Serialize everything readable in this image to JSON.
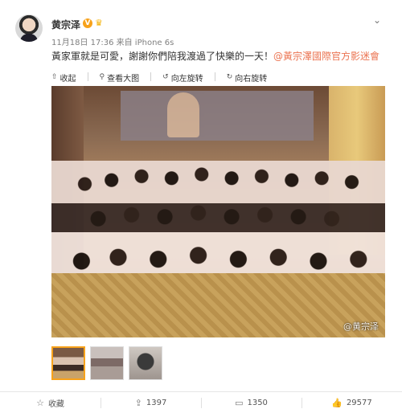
{
  "post": {
    "username": "黄宗泽",
    "verified_badge": "V",
    "meta": "11月18日 17:36 来自 iPhone 6s",
    "text_main": "黃家軍就是可愛，謝謝你們陪我渡過了快樂的一天！",
    "text_mention": "@黃宗澤國際官方影迷會",
    "more_icon": "chevron-down-icon"
  },
  "toolbar": {
    "collapse_label": "收起",
    "view_large_label": "查看大图",
    "rotate_left_label": "向左旋转",
    "rotate_right_label": "向右旋转"
  },
  "photo": {
    "watermark": "@黄宗泽"
  },
  "thumbnails": [
    "thumb-1",
    "thumb-2",
    "thumb-3"
  ],
  "footer": {
    "favorite_label": "收藏",
    "repost_count": "1397",
    "comment_count": "1350",
    "like_count": "29577"
  },
  "colors": {
    "mention": "#eb7350",
    "badge": "#f7a21b"
  }
}
